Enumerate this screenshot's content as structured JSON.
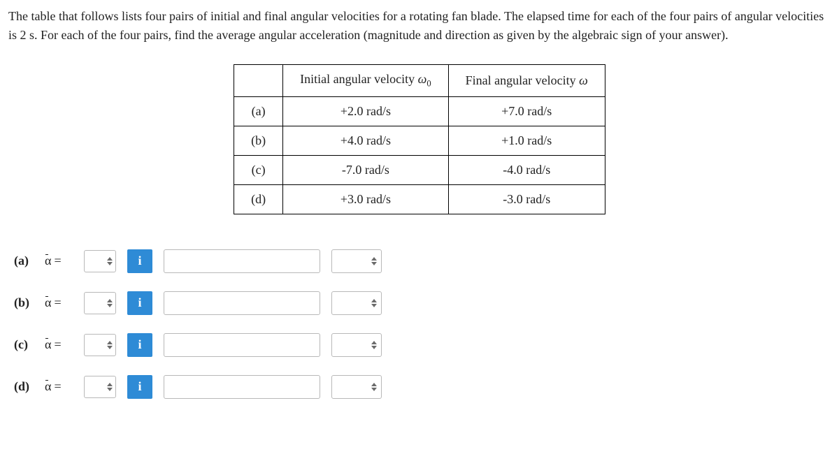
{
  "problem_text": "The table that follows lists four pairs of initial and final angular velocities for a rotating fan blade. The elapsed time for each of the four pairs of angular velocities is 2 s. For each of the four pairs, find the average angular acceleration (magnitude and direction as given by the algebraic sign of your answer).",
  "table": {
    "header_initial_prefix": "Initial angular velocity ",
    "header_initial_var": "ω",
    "header_initial_sub": "0",
    "header_final_prefix": "Final angular velocity ",
    "header_final_var": "ω",
    "rows": [
      {
        "label": "(a)",
        "initial": "+2.0 rad/s",
        "final": "+7.0 rad/s"
      },
      {
        "label": "(b)",
        "initial": "+4.0 rad/s",
        "final": "+1.0 rad/s"
      },
      {
        "label": "(c)",
        "initial": "-7.0 rad/s",
        "final": "-4.0 rad/s"
      },
      {
        "label": "(d)",
        "initial": "+3.0 rad/s",
        "final": "-3.0 rad/s"
      }
    ]
  },
  "answers": {
    "alpha_symbol": "α",
    "equals": " =",
    "info_label": "i",
    "parts": [
      {
        "label": "(a)"
      },
      {
        "label": "(b)"
      },
      {
        "label": "(c)"
      },
      {
        "label": "(d)"
      }
    ]
  }
}
